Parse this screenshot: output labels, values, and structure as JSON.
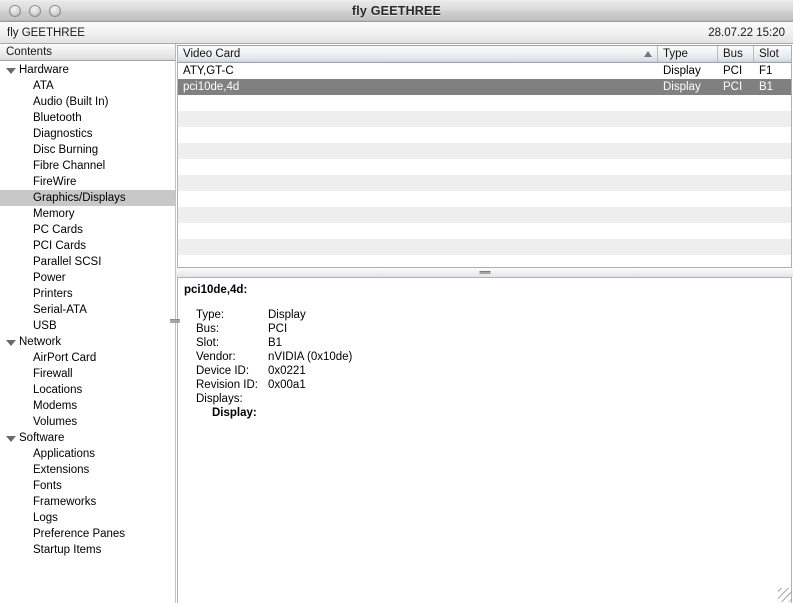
{
  "window": {
    "title": "fly GEETHREE",
    "traffic_lights": [
      "close-button",
      "minimize-button",
      "zoom-button"
    ]
  },
  "substrip": {
    "document_name": "fly GEETHREE",
    "timestamp": "28.07.22 15:20"
  },
  "sidebar": {
    "header": "Contents",
    "items": [
      {
        "label": "Hardware",
        "type": "group",
        "expanded": true,
        "selected": false
      },
      {
        "label": "ATA",
        "type": "child",
        "selected": false
      },
      {
        "label": "Audio (Built In)",
        "type": "child",
        "selected": false
      },
      {
        "label": "Bluetooth",
        "type": "child",
        "selected": false
      },
      {
        "label": "Diagnostics",
        "type": "child",
        "selected": false
      },
      {
        "label": "Disc Burning",
        "type": "child",
        "selected": false
      },
      {
        "label": "Fibre Channel",
        "type": "child",
        "selected": false
      },
      {
        "label": "FireWire",
        "type": "child",
        "selected": false
      },
      {
        "label": "Graphics/Displays",
        "type": "child",
        "selected": true
      },
      {
        "label": "Memory",
        "type": "child",
        "selected": false
      },
      {
        "label": "PC Cards",
        "type": "child",
        "selected": false
      },
      {
        "label": "PCI Cards",
        "type": "child",
        "selected": false
      },
      {
        "label": "Parallel SCSI",
        "type": "child",
        "selected": false
      },
      {
        "label": "Power",
        "type": "child",
        "selected": false
      },
      {
        "label": "Printers",
        "type": "child",
        "selected": false
      },
      {
        "label": "Serial-ATA",
        "type": "child",
        "selected": false
      },
      {
        "label": "USB",
        "type": "child",
        "selected": false
      },
      {
        "label": "Network",
        "type": "group",
        "expanded": true,
        "selected": false
      },
      {
        "label": "AirPort Card",
        "type": "child",
        "selected": false
      },
      {
        "label": "Firewall",
        "type": "child",
        "selected": false
      },
      {
        "label": "Locations",
        "type": "child",
        "selected": false
      },
      {
        "label": "Modems",
        "type": "child",
        "selected": false
      },
      {
        "label": "Volumes",
        "type": "child",
        "selected": false
      },
      {
        "label": "Software",
        "type": "group",
        "expanded": true,
        "selected": false
      },
      {
        "label": "Applications",
        "type": "child",
        "selected": false
      },
      {
        "label": "Extensions",
        "type": "child",
        "selected": false
      },
      {
        "label": "Fonts",
        "type": "child",
        "selected": false
      },
      {
        "label": "Frameworks",
        "type": "child",
        "selected": false
      },
      {
        "label": "Logs",
        "type": "child",
        "selected": false
      },
      {
        "label": "Preference Panes",
        "type": "child",
        "selected": false
      },
      {
        "label": "Startup Items",
        "type": "child",
        "selected": false
      }
    ]
  },
  "table": {
    "columns": [
      {
        "key": "name",
        "label": "Video Card",
        "sorted": true,
        "sort_dir": "asc"
      },
      {
        "key": "type",
        "label": "Type",
        "sorted": false
      },
      {
        "key": "bus",
        "label": "Bus",
        "sorted": false
      },
      {
        "key": "slot",
        "label": "Slot",
        "sorted": false
      }
    ],
    "rows": [
      {
        "name": "ATY,GT-C",
        "type": "Display",
        "bus": "PCI",
        "slot": "F1",
        "selected": false
      },
      {
        "name": "pci10de,4d",
        "type": "Display",
        "bus": "PCI",
        "slot": "B1",
        "selected": true
      }
    ],
    "empty_row_count": 11
  },
  "detail": {
    "title": "pci10de,4d:",
    "fields": [
      {
        "key": "Type:",
        "value": "Display"
      },
      {
        "key": "Bus:",
        "value": "PCI"
      },
      {
        "key": "Slot:",
        "value": "B1"
      },
      {
        "key": "Vendor:",
        "value": "nVIDIA (0x10de)"
      },
      {
        "key": "Device ID:",
        "value": "0x0221"
      },
      {
        "key": "Revision ID:",
        "value": "0x00a1"
      }
    ],
    "displays_label": "Displays:",
    "display_sub_label": "Display:"
  },
  "colors": {
    "selection_row": "#808080",
    "selection_sidebar": "#c8c8c8",
    "row_alt": "#eeeeee",
    "titlebar_text": "#2a2a2a"
  }
}
